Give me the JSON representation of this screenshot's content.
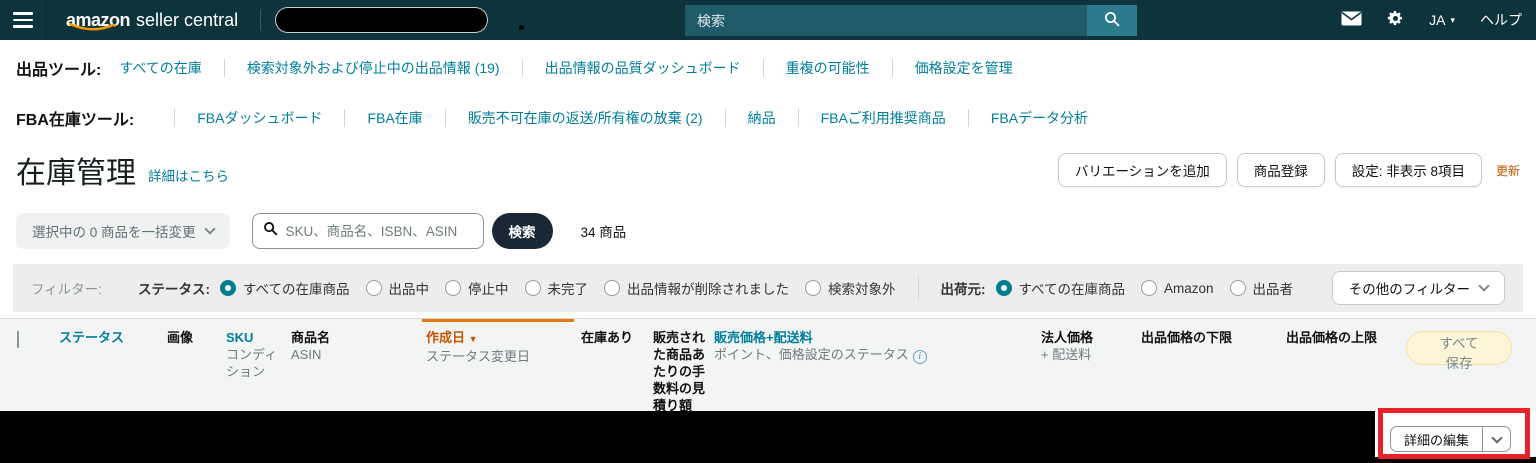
{
  "icons": {
    "sort_desc": "▼",
    "lang_caret": "▾",
    "info": "i"
  },
  "colors": {
    "nav_bg": "#0d333c",
    "nav_search_bg": "#1f5b68",
    "nav_search_btn": "#2c7b8d",
    "link_teal": "#007e9c",
    "orange_accent": "#c45500",
    "sort_bar_orange": "#e47911",
    "radio_teal": "#00808e",
    "annotation_red": "#e8212b",
    "dark_button": "#1a2734",
    "save_all_bg": "#fcf5d8",
    "filter_bar_bg": "#ededee",
    "table_header_bg": "#f3f4f4"
  },
  "navbar": {
    "logo_primary": "amazon",
    "logo_secondary": "seller central",
    "search_placeholder": "検索",
    "lang": "JA",
    "help": "ヘルプ"
  },
  "listing_tools": {
    "label": "出品ツール:",
    "links": [
      "すべての在庫",
      "検索対象外および停止中の出品情報 (19)",
      "出品情報の品質ダッシュボード",
      "重複の可能性",
      "価格設定を管理"
    ]
  },
  "fba_tools": {
    "label": "FBA在庫ツール:",
    "links": [
      "FBAダッシュボード",
      "FBA在庫",
      "販売不可在庫の返送/所有権の放棄 (2)",
      "納品",
      "FBAご利用推奨商品",
      "FBAデータ分析"
    ]
  },
  "page_header": {
    "title": "在庫管理",
    "help_link": "詳細はこちら",
    "add_variation_button": "バリエーションを追加",
    "add_product_button": "商品登録",
    "settings_button": "設定: 非表示 8項目",
    "refresh_link": "更新"
  },
  "toolbar": {
    "bulk_action_label": "選択中の 0 商品を一括変更",
    "search_placeholder": "SKU、商品名、ISBN、ASIN",
    "search_button": "検索",
    "result_count": "34 商品"
  },
  "filters": {
    "label": "フィルター:",
    "status_label": "ステータス:",
    "status_options": [
      {
        "label": "すべての在庫商品",
        "selected": true
      },
      {
        "label": "出品中",
        "selected": false
      },
      {
        "label": "停止中",
        "selected": false
      },
      {
        "label": "未完了",
        "selected": false
      },
      {
        "label": "出品情報が削除されました",
        "selected": false
      },
      {
        "label": "検索対象外",
        "selected": false
      }
    ],
    "fulfillment_label": "出荷元:",
    "fulfillment_options": [
      {
        "label": "すべての在庫商品",
        "selected": true
      },
      {
        "label": "Amazon",
        "selected": false
      },
      {
        "label": "出品者",
        "selected": false
      }
    ],
    "more_filters_button": "その他のフィルター"
  },
  "table": {
    "columns": [
      {
        "primary": "ステータス",
        "secondary": ""
      },
      {
        "primary": "画像",
        "secondary": ""
      },
      {
        "primary": "SKU",
        "secondary": "コンディション"
      },
      {
        "primary": "商品名",
        "secondary": "ASIN"
      },
      {
        "primary": "作成日",
        "secondary": "ステータス変更日",
        "sorted": "desc"
      },
      {
        "primary": "在庫あり",
        "secondary": ""
      },
      {
        "primary": "販売された商品あたりの手数料の見積り額",
        "secondary": ""
      },
      {
        "primary": "販売価格+配送料",
        "secondary": "ポイント、価格設定のステータス"
      },
      {
        "primary": "法人価格",
        "secondary": "+ 配送料"
      },
      {
        "primary": "出品価格の下限",
        "secondary": ""
      },
      {
        "primary": "出品価格の上限",
        "secondary": ""
      }
    ],
    "save_all_button": "すべて保存"
  },
  "footer": {
    "edit_details_button": "詳細の編集"
  }
}
